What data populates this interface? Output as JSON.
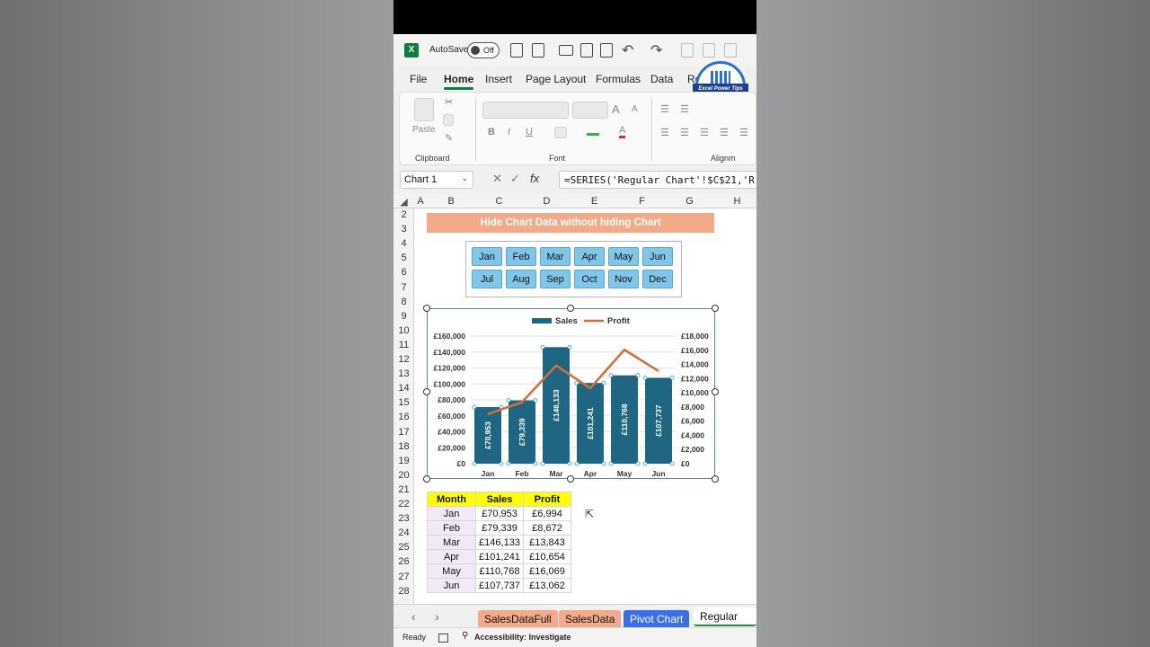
{
  "titlebar": {
    "autosave_label": "AutoSave",
    "toggle_state": "Off",
    "app_logo": "X"
  },
  "ribbon_tabs": [
    "File",
    "Home",
    "Insert",
    "Page Layout",
    "Formulas",
    "Data",
    "Re"
  ],
  "active_tab": "Home",
  "badge": {
    "text": "Excel Power Tips"
  },
  "ribbon": {
    "paste_label": "Paste",
    "groups": {
      "clipboard": "Clipboard",
      "font": "Font",
      "alignment": "Alignm"
    },
    "font_buttons": [
      "B",
      "I",
      "U",
      "A"
    ]
  },
  "formula_bar": {
    "name_box": "Chart 1",
    "fx": "fx",
    "formula": "=SERIES('Regular Chart'!$C$21,'R"
  },
  "columns": [
    "A",
    "B",
    "C",
    "D",
    "E",
    "F",
    "G",
    "H"
  ],
  "rows": [
    "2",
    "3",
    "4",
    "5",
    "6",
    "7",
    "8",
    "9",
    "10",
    "11",
    "12",
    "13",
    "14",
    "15",
    "16",
    "17",
    "18",
    "19",
    "20",
    "21",
    "22",
    "23",
    "24",
    "25",
    "26",
    "27",
    "28"
  ],
  "banner": "Hide Chart Data without hiding Chart",
  "slicer_months": [
    [
      "Jan",
      "Feb",
      "Mar",
      "Apr",
      "May",
      "Jun"
    ],
    [
      "Jul",
      "Aug",
      "Sep",
      "Oct",
      "Nov",
      "Dec"
    ]
  ],
  "chart_data": {
    "type": "bar",
    "categories": [
      "Jan",
      "Feb",
      "Mar",
      "Apr",
      "May",
      "Jun"
    ],
    "series": [
      {
        "name": "Sales",
        "type": "bar",
        "axis": "left",
        "values": [
          70953,
          79339,
          146133,
          101241,
          110768,
          107737
        ],
        "labels": [
          "£70,953",
          "£79,339",
          "£146,133",
          "£101,241",
          "£110,768",
          "£107,737"
        ],
        "color": "#1f6682"
      },
      {
        "name": "Profit",
        "type": "line",
        "axis": "right",
        "values": [
          6994,
          8672,
          13843,
          10654,
          16069,
          13062
        ],
        "color": "#d0703a"
      }
    ],
    "y_left": {
      "range": [
        0,
        160000
      ],
      "ticks": [
        "£0",
        "£20,000",
        "£40,000",
        "£60,000",
        "£80,000",
        "£100,000",
        "£120,000",
        "£140,000",
        "£160,000"
      ]
    },
    "y_right": {
      "range": [
        0,
        18000
      ],
      "ticks": [
        "£0",
        "£2,000",
        "£4,000",
        "£6,000",
        "£8,000",
        "£10,000",
        "£12,000",
        "£14,000",
        "£16,000",
        "£18,000"
      ]
    },
    "legend_position": "top",
    "grid": true
  },
  "table": {
    "headers": [
      "Month",
      "Sales",
      "Profit"
    ],
    "rows": [
      [
        "Jan",
        "£70,953",
        "£6,994"
      ],
      [
        "Feb",
        "£79,339",
        "£8,672"
      ],
      [
        "Mar",
        "£146,133",
        "£13,843"
      ],
      [
        "Apr",
        "£101,241",
        "£10,654"
      ],
      [
        "May",
        "£110,768",
        "£16,069"
      ],
      [
        "Jun",
        "£107,737",
        "£13,062"
      ]
    ]
  },
  "sheet_tabs": [
    {
      "label": "SalesDataFull",
      "color": "#f4a988"
    },
    {
      "label": "SalesData",
      "color": "#f4a988"
    },
    {
      "label": "Pivot Chart",
      "color": "#3a6fe6"
    },
    {
      "label": "Regular Cha",
      "color": "#ffffff"
    }
  ],
  "status": {
    "ready": "Ready",
    "accessibility": "Accessibility: Investigate"
  }
}
